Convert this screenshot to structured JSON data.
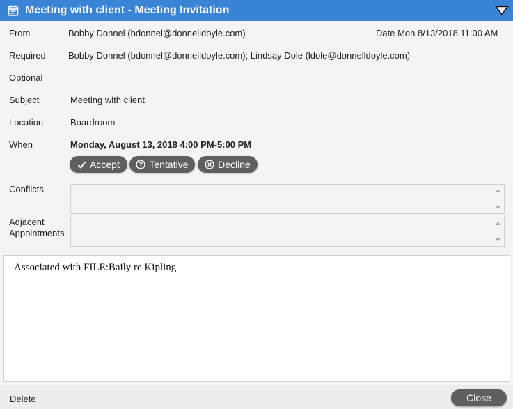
{
  "window": {
    "title": "Meeting with client - Meeting Invitation",
    "title_icon": "calendar-icon",
    "collapse_icon": "triangle-down-icon",
    "accent_color": "#3a84d6"
  },
  "fields": {
    "from_label": "From",
    "from_value": "Bobby Donnel (bdonnel@donnelldoyle.com)",
    "date_text": "Date Mon 8/13/2018 11:00 AM",
    "required_label": "Required",
    "required_value": "Bobby Donnel (bdonnel@donnelldoyle.com); Lindsay Dole (ldole@donnelldoyle.com)",
    "optional_label": "Optional",
    "optional_value": "",
    "subject_label": "Subject",
    "subject_value": "Meeting with client",
    "location_label": "Location",
    "location_value": "Boardroom",
    "when_label": "When",
    "when_value": "Monday, August 13, 2018 4:00 PM-5:00 PM"
  },
  "responses": {
    "accept_label": "Accept",
    "tentative_label": "Tentative",
    "decline_label": "Decline",
    "button_color": "#5f5f5f"
  },
  "lists": {
    "conflicts_label": "Conflicts",
    "adjacent_label_line1": "Adjacent",
    "adjacent_label_line2": "Appointments"
  },
  "body": {
    "text": "Associated with FILE:Baily re Kipling"
  },
  "footer": {
    "delete_label": "Delete",
    "close_label": "Close"
  }
}
